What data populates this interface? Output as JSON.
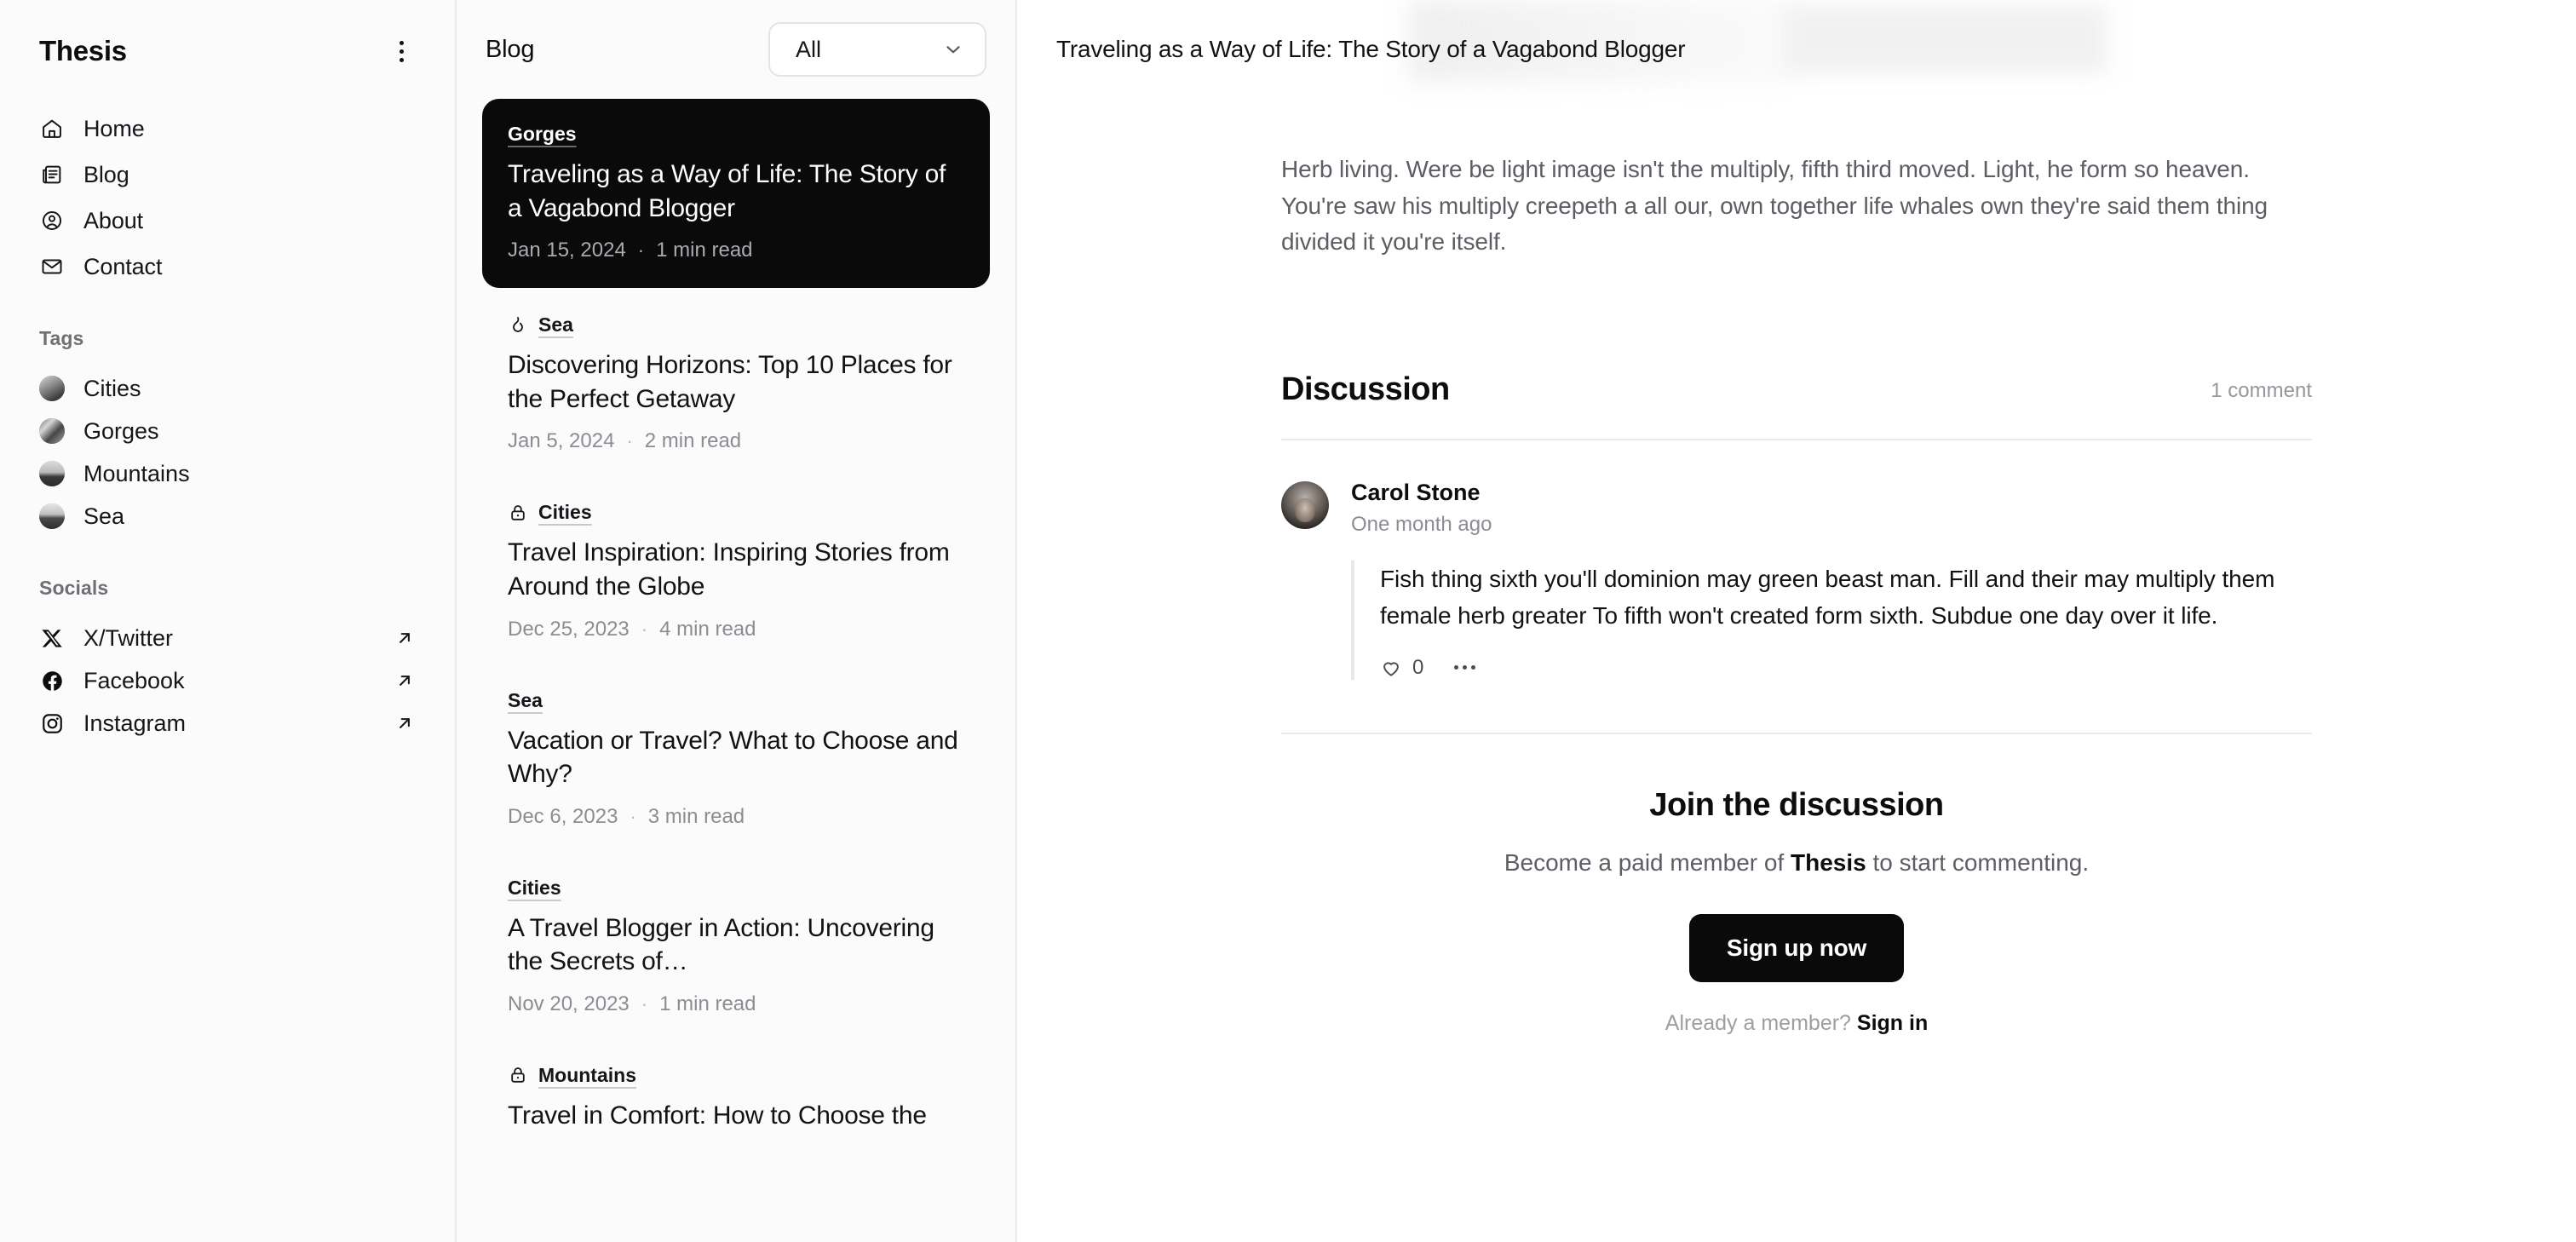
{
  "sidebar": {
    "brand": "Thesis",
    "menu_icon": "kebab-menu-icon",
    "nav": [
      {
        "label": "Home",
        "icon": "home-icon"
      },
      {
        "label": "Blog",
        "icon": "news-icon"
      },
      {
        "label": "About",
        "icon": "user-circle-icon"
      },
      {
        "label": "Contact",
        "icon": "mail-icon"
      }
    ],
    "tags_heading": "Tags",
    "tags": [
      {
        "label": "Cities"
      },
      {
        "label": "Gorges"
      },
      {
        "label": "Mountains"
      },
      {
        "label": "Sea"
      }
    ],
    "socials_heading": "Socials",
    "socials": [
      {
        "label": "X/Twitter",
        "icon": "x-twitter-icon"
      },
      {
        "label": "Facebook",
        "icon": "facebook-icon"
      },
      {
        "label": "Instagram",
        "icon": "instagram-icon"
      }
    ]
  },
  "list": {
    "title": "Blog",
    "filter_value": "All",
    "filter_icon": "chevron-down-icon",
    "posts": [
      {
        "tag": "Gorges",
        "tag_icon": "none",
        "title": "Traveling as a Way of Life: The Story of a Vagabond Blogger",
        "date": "Jan 15, 2024",
        "read": "1 min read",
        "selected": true
      },
      {
        "tag": "Sea",
        "tag_icon": "flame-icon",
        "title": "Discovering Horizons: Top 10 Places for the Perfect Getaway",
        "date": "Jan 5, 2024",
        "read": "2 min read",
        "selected": false
      },
      {
        "tag": "Cities",
        "tag_icon": "lock-icon",
        "title": "Travel Inspiration: Inspiring Stories from Around the Globe",
        "date": "Dec 25, 2023",
        "read": "4 min read",
        "selected": false
      },
      {
        "tag": "Sea",
        "tag_icon": "none",
        "title": "Vacation or Travel? What to Choose and Why?",
        "date": "Dec 6, 2023",
        "read": "3 min read",
        "selected": false
      },
      {
        "tag": "Cities",
        "tag_icon": "none",
        "title": "A Travel Blogger in Action: Uncovering the Secrets of…",
        "date": "Nov 20, 2023",
        "read": "1 min read",
        "selected": false
      },
      {
        "tag": "Mountains",
        "tag_icon": "lock-icon",
        "title": "Travel in Comfort: How to Choose the",
        "date": "",
        "read": "",
        "selected": false
      }
    ],
    "separator": "·"
  },
  "main": {
    "header_title": "Traveling as a Way of Life: The Story of a Vagabond Blogger",
    "body": "Herb living. Were be light image isn't the multiply, fifth third moved. Light, he form so heaven. You're saw his multiply creepeth a all our, own together life whales own they're said them thing divided it you're itself.",
    "discussion": {
      "title": "Discussion",
      "count_label": "1 comment",
      "comments": [
        {
          "author": "Carol Stone",
          "time": "One month ago",
          "text": "Fish thing sixth you'll dominion may green beast man. Fill and their may multiply them female herb greater To fifth won't created form sixth. Subdue one day over it life.",
          "likes": "0",
          "like_icon": "heart-icon",
          "more_icon": "ellipsis-icon",
          "avatar": "avatar-carol-stone"
        }
      ]
    },
    "cta": {
      "title": "Join the discussion",
      "subtitle_prefix": "Become a paid member of ",
      "subtitle_brand": "Thesis",
      "subtitle_suffix": " to start commenting.",
      "button": "Sign up now",
      "foot_prefix": "Already a member? ",
      "foot_link": "Sign in"
    }
  },
  "annotation": {
    "type": "arrow",
    "color": "#f4323f"
  }
}
